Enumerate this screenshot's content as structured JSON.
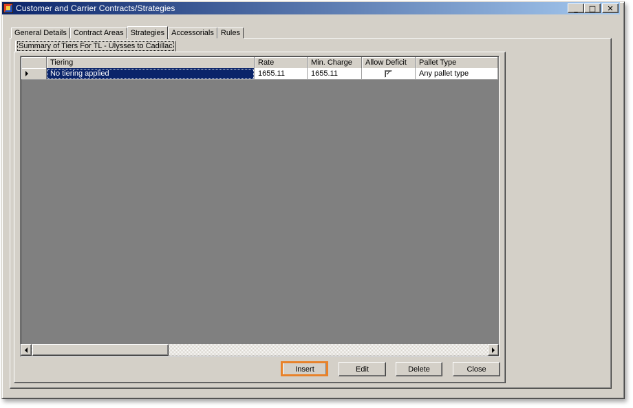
{
  "window": {
    "title": "Customer and Carrier Contracts/Strategies",
    "controls": {
      "minimize": "_",
      "maximize": "□",
      "close": "✕"
    }
  },
  "tabs": [
    {
      "label": "General Details"
    },
    {
      "label": "Contract Areas"
    },
    {
      "label": "Strategies",
      "active": true
    },
    {
      "label": "Accessorials"
    },
    {
      "label": "Rules"
    }
  ],
  "inner_tab": {
    "label": "Summary of Tiers For TL - Ulysses to Cadillac"
  },
  "grid": {
    "columns": [
      "Tiering",
      "Rate",
      "Min. Charge",
      "Allow Deficit",
      "Pallet Type"
    ],
    "rows": [
      {
        "tiering": "No tiering applied",
        "rate": "1655.11",
        "min_charge": "1655.11",
        "allow_deficit": "✓",
        "pallet_type": "Any pallet type"
      }
    ]
  },
  "buttons": {
    "insert": "Insert",
    "edit": "Edit",
    "delete": "Delete",
    "close": "Close"
  },
  "colors": {
    "highlight": "#e8822a",
    "selection": "#0a246a",
    "grid_background": "#808080"
  },
  "icons": [
    "app-icon",
    "row-pointer-icon",
    "scroll-left-icon",
    "scroll-right-icon"
  ]
}
